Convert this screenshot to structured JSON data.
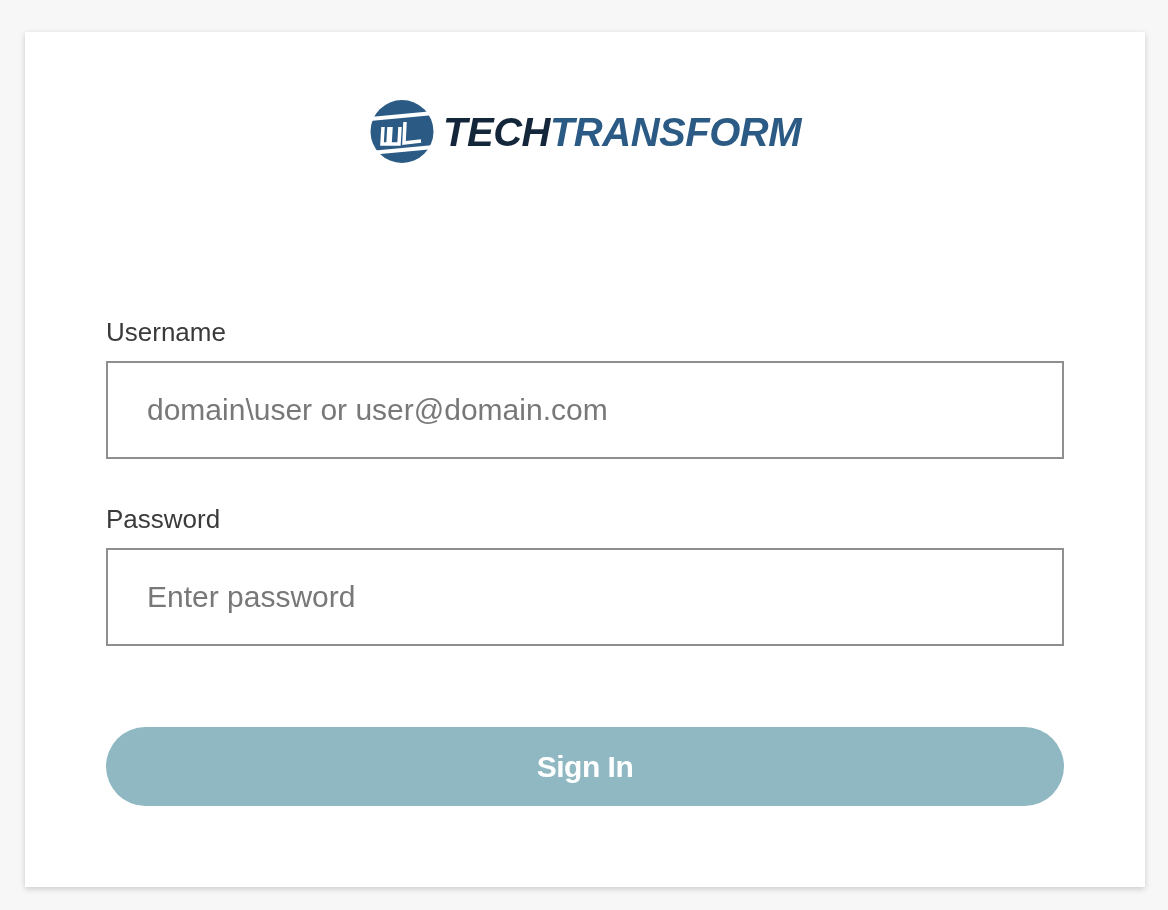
{
  "logo": {
    "wordmark": [
      "TECH",
      "TRANSFORM"
    ]
  },
  "form": {
    "fields": [
      {
        "label": "Username",
        "placeholder": "domain\\user or user@domain.com"
      },
      {
        "label": "Password",
        "placeholder": "Enter password"
      }
    ],
    "submit_button": "Sign In"
  }
}
